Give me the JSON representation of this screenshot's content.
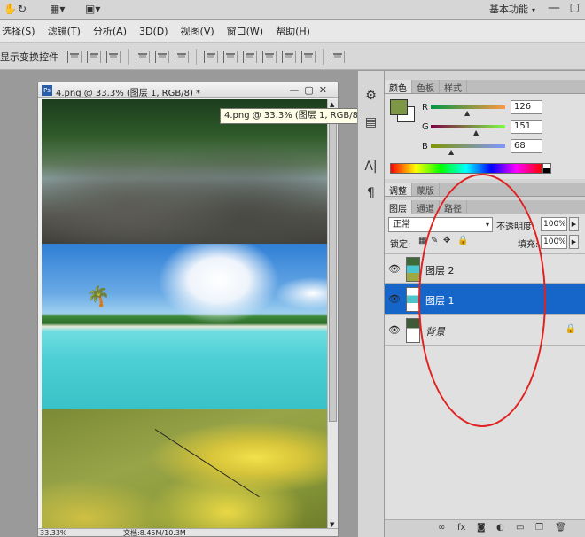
{
  "appbar": {
    "workspace_label": "基本功能",
    "arrow_icon": "▾",
    "minimize": "—",
    "restore": "▢"
  },
  "menubar": {
    "items": [
      "选择(S)",
      "滤镜(T)",
      "分析(A)",
      "3D(D)",
      "视图(V)",
      "窗口(W)",
      "帮助(H)"
    ]
  },
  "optbar": {
    "show_transform_controls": "显示变换控件"
  },
  "document": {
    "title": "4.png @ 33.3% (图层 1, RGB/8) *",
    "ps_badge": "Ps",
    "window_buttons": "—▢✕",
    "zoom": "33.33%",
    "doc_size": "文档:8.45M/10.3M"
  },
  "tooltip": {
    "text": "4.png @ 33.3% (图层 1, RGB/8) *"
  },
  "color_panel": {
    "tabs": [
      "颜色",
      "色板",
      "样式"
    ],
    "r_label": "R",
    "g_label": "G",
    "b_label": "B",
    "r": "126",
    "g": "151",
    "b": "68",
    "fg_color": "#7e9744",
    "bg_color": "#ffffff"
  },
  "adjust_tabs": [
    "调整",
    "蒙版"
  ],
  "layers_panel": {
    "tabs": [
      "图层",
      "通道",
      "路径"
    ],
    "blend_mode": "正常",
    "opacity_label": "不透明度:",
    "opacity": "100%",
    "lock_label": "锁定:",
    "fill_label": "填充:",
    "fill": "100%",
    "layers": [
      {
        "name": "图层 2",
        "visible": true,
        "selected": false,
        "locked": false
      },
      {
        "name": "图层 1",
        "visible": true,
        "selected": true,
        "locked": false
      },
      {
        "name": "背景",
        "visible": true,
        "selected": false,
        "locked": true
      }
    ]
  },
  "colors": {
    "selection": "#1665c9",
    "annotation": "#e02222"
  }
}
